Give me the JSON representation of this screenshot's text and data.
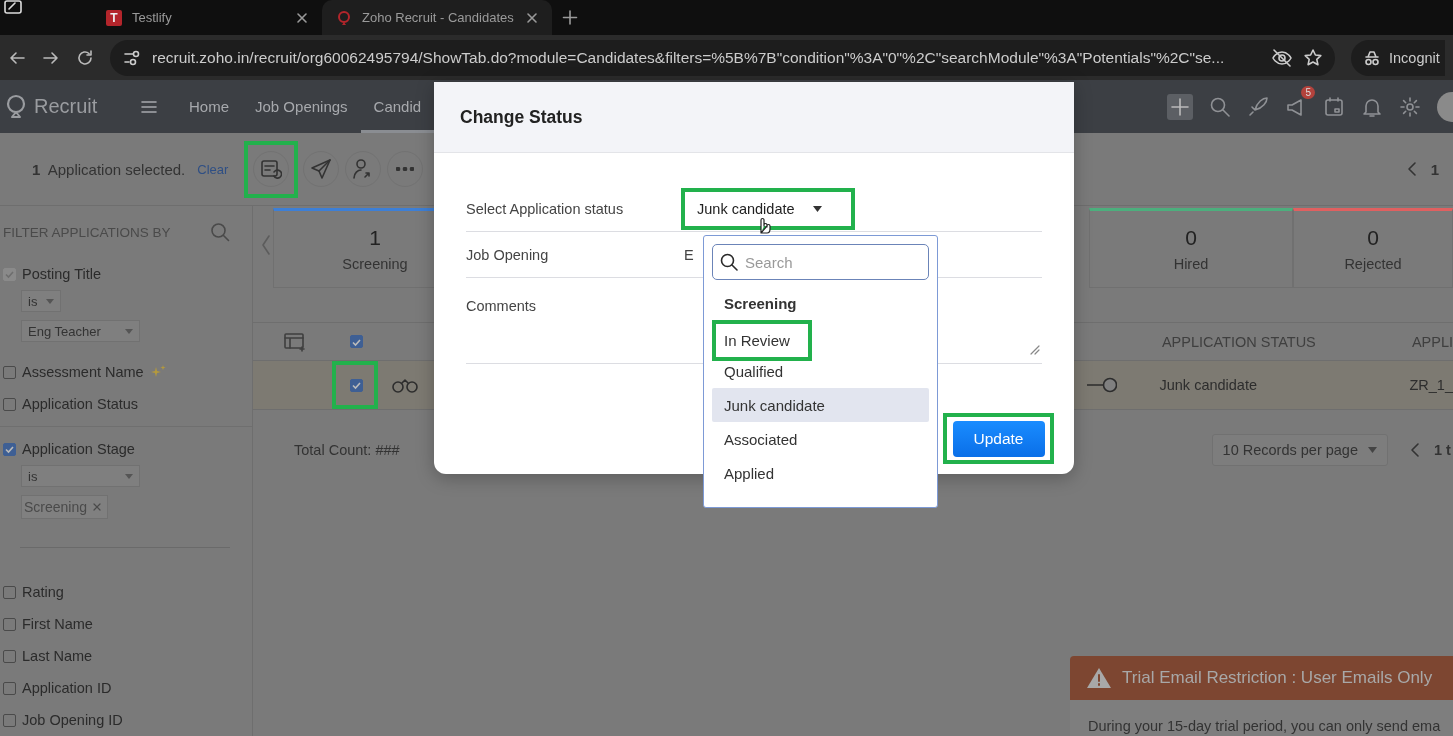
{
  "browser": {
    "tabs": [
      {
        "title": "Testlify",
        "favicon": "T",
        "selected": false
      },
      {
        "title": "Zoho Recruit - Candidates",
        "selected": true
      }
    ],
    "url": "recruit.zoho.in/recruit/org60062495794/ShowTab.do?module=Candidates&filters=%5B%7B\"condition\"%3A\"0\"%2C\"searchModule\"%3A\"Potentials\"%2C\"se...",
    "profile": "Incognit"
  },
  "app": {
    "name": "Recruit",
    "nav": [
      {
        "label": "Home",
        "selected": false
      },
      {
        "label": "Job Openings",
        "selected": false
      },
      {
        "label": "Candid",
        "selected": true
      }
    ],
    "notification_count": "5"
  },
  "selection": {
    "count": "1",
    "text": "Application selected.",
    "clear": "Clear",
    "actions": [
      {
        "kind": "status",
        "highlighted": true
      },
      {
        "kind": "send",
        "highlighted": false
      },
      {
        "kind": "assign",
        "highlighted": false
      },
      {
        "kind": "more",
        "highlighted": false
      }
    ],
    "page": "1"
  },
  "filter_panel": {
    "title": "FILTER APPLICATIONS BY",
    "filters": [
      {
        "label": "Posting Title",
        "checked": true,
        "disabled": true,
        "ai": false,
        "divider": false,
        "operator": "is",
        "value": "Eng Teacher"
      },
      {
        "label": "Assessment Name",
        "checked": false,
        "disabled": false,
        "ai": true,
        "divider": false
      },
      {
        "label": "Application Status",
        "checked": false,
        "disabled": false,
        "ai": false,
        "divider": true
      },
      {
        "label": "Application Stage",
        "checked": true,
        "disabled": false,
        "ai": false,
        "operator": "is",
        "tag": "Screening",
        "divider": true
      },
      {
        "label": "Rating",
        "checked": false,
        "disabled": false,
        "ai": false,
        "divider": false
      },
      {
        "label": "First Name",
        "checked": false,
        "disabled": false,
        "ai": false,
        "divider": false
      },
      {
        "label": "Last Name",
        "checked": false,
        "disabled": false,
        "ai": false,
        "divider": false
      },
      {
        "label": "Application ID",
        "checked": false,
        "disabled": false,
        "ai": false,
        "divider": false
      },
      {
        "label": "Job Opening ID",
        "checked": false,
        "disabled": false,
        "ai": false,
        "divider": false
      }
    ]
  },
  "stages": [
    {
      "count": "1",
      "label": "Screening",
      "color": "#3d7fd6"
    },
    {
      "count": "0",
      "label": "Hired",
      "color": "#4caf7d"
    },
    {
      "count": "0",
      "label": "Rejected",
      "color": "#e06060"
    }
  ],
  "table": {
    "header_checked": true,
    "columns": [
      "APPLICATION STATUS",
      "APPLI"
    ],
    "rows": [
      {
        "checked": true,
        "highlighted": true,
        "cells": [
          "Junk candidate",
          "ZR_1_"
        ]
      }
    ],
    "total": "Total Count: ###",
    "page_size": "10 Records per page",
    "page": "1 t"
  },
  "dialog": {
    "title": "Change Status",
    "fields": [
      {
        "kind": "select",
        "label": "Select Application status",
        "value": "Junk candidate",
        "highlighted": true
      },
      {
        "kind": "text",
        "label": "Job Opening",
        "value": "E"
      },
      {
        "kind": "textarea",
        "label": "Comments"
      }
    ],
    "dropdown": {
      "placeholder": "Search",
      "group": "Screening",
      "options": [
        {
          "label": "In Review",
          "selected": false,
          "highlighted": true
        },
        {
          "label": "Qualified",
          "selected": false,
          "highlighted": false
        },
        {
          "label": "Junk candidate",
          "selected": true,
          "highlighted": false
        },
        {
          "label": "Associated",
          "selected": false,
          "highlighted": false
        },
        {
          "label": "Applied",
          "selected": false,
          "highlighted": false
        }
      ]
    },
    "update": {
      "label": "Update",
      "highlighted": true
    }
  },
  "toast": {
    "title": "Trial Email Restriction : User Emails Only",
    "body": "During your 15-day trial period, you can only send ema"
  }
}
